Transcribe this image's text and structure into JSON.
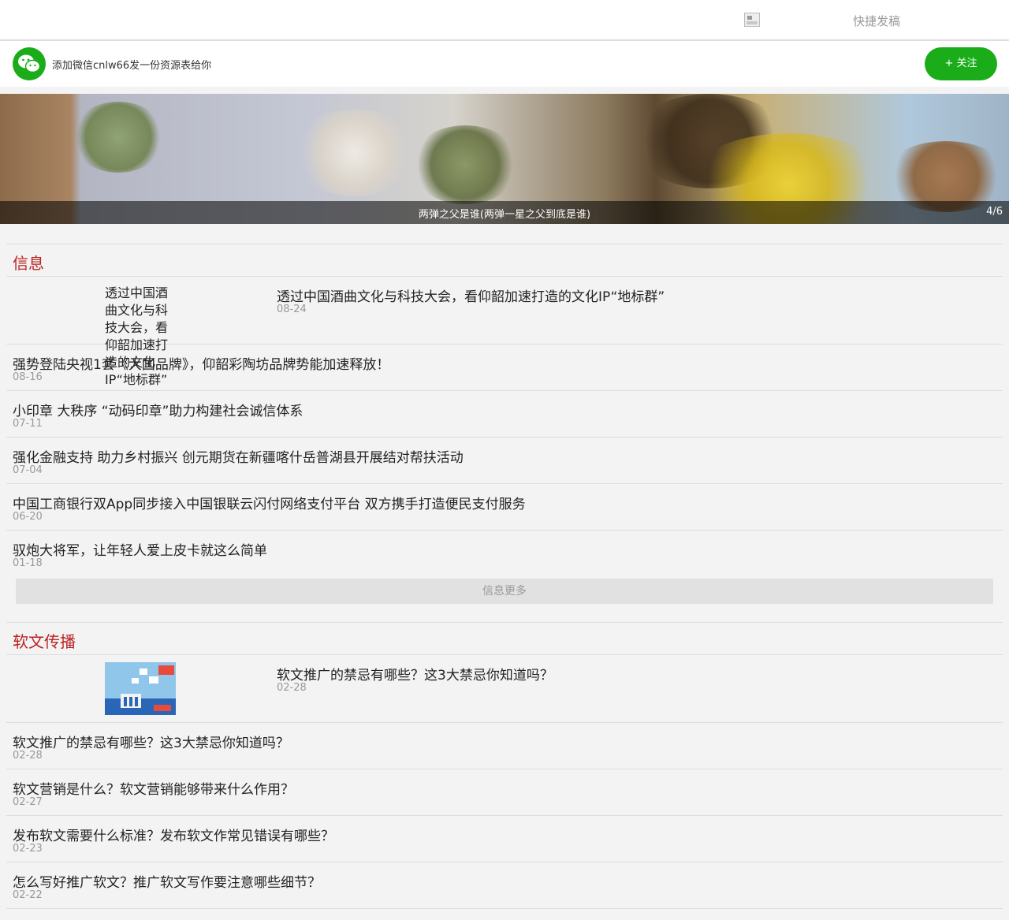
{
  "topbar": {
    "image_icon": "broken-image-icon",
    "quick_post": "快捷发稿"
  },
  "wechat": {
    "icon": "wechat-icon",
    "message": "添加微信cnlw66发一份资源表给你",
    "follow_label": "+ 关注"
  },
  "banner": {
    "caption": "两弹之父是谁(两弹一星之父到底是谁)",
    "counter": "4/6"
  },
  "sections": {
    "news": {
      "title": "信息",
      "feature": {
        "image_alt": "透过中国酒曲文化与科技大会，看仰韶加速打造的文化IP“地标群”",
        "title": "透过中国酒曲文化与科技大会，看仰韶加速打造的文化IP“地标群”",
        "date": "08-24"
      },
      "items": [
        {
          "title": "强势登陆央视1套《大国品牌》，仰韶彩陶坊品牌势能加速释放！",
          "date": "08-16"
        },
        {
          "title": "小印章 大秩序 “动码印章”助力构建社会诚信体系",
          "date": "07-11"
        },
        {
          "title": "强化金融支持 助力乡村振兴 创元期货在新疆喀什岳普湖县开展结对帮扶活动",
          "date": "07-04"
        },
        {
          "title": "中国工商银行双App同步接入中国银联云闪付网络支付平台 双方携手打造便民支付服务",
          "date": "06-20"
        },
        {
          "title": "驭炮大将军，让年轻人爱上皮卡就这么简单",
          "date": "01-18"
        }
      ],
      "more_label": "信息更多"
    },
    "pr": {
      "title": "软文传播",
      "feature": {
        "title": "软文推广的禁忌有哪些？这3大禁忌你知道吗？",
        "date": "02-28"
      },
      "items": [
        {
          "title": "软文推广的禁忌有哪些？这3大禁忌你知道吗？",
          "date": "02-28"
        },
        {
          "title": "软文营销是什么？软文营销能够带来什么作用？",
          "date": "02-27"
        },
        {
          "title": "发布软文需要什么标准？发布软文作常见错误有哪些？",
          "date": "02-23"
        },
        {
          "title": "怎么写好推广软文？推广软文写作要注意哪些细节？",
          "date": "02-22"
        }
      ]
    }
  },
  "colors": {
    "wechat_green": "#1aad19",
    "section_title_red": "#bb2222"
  }
}
